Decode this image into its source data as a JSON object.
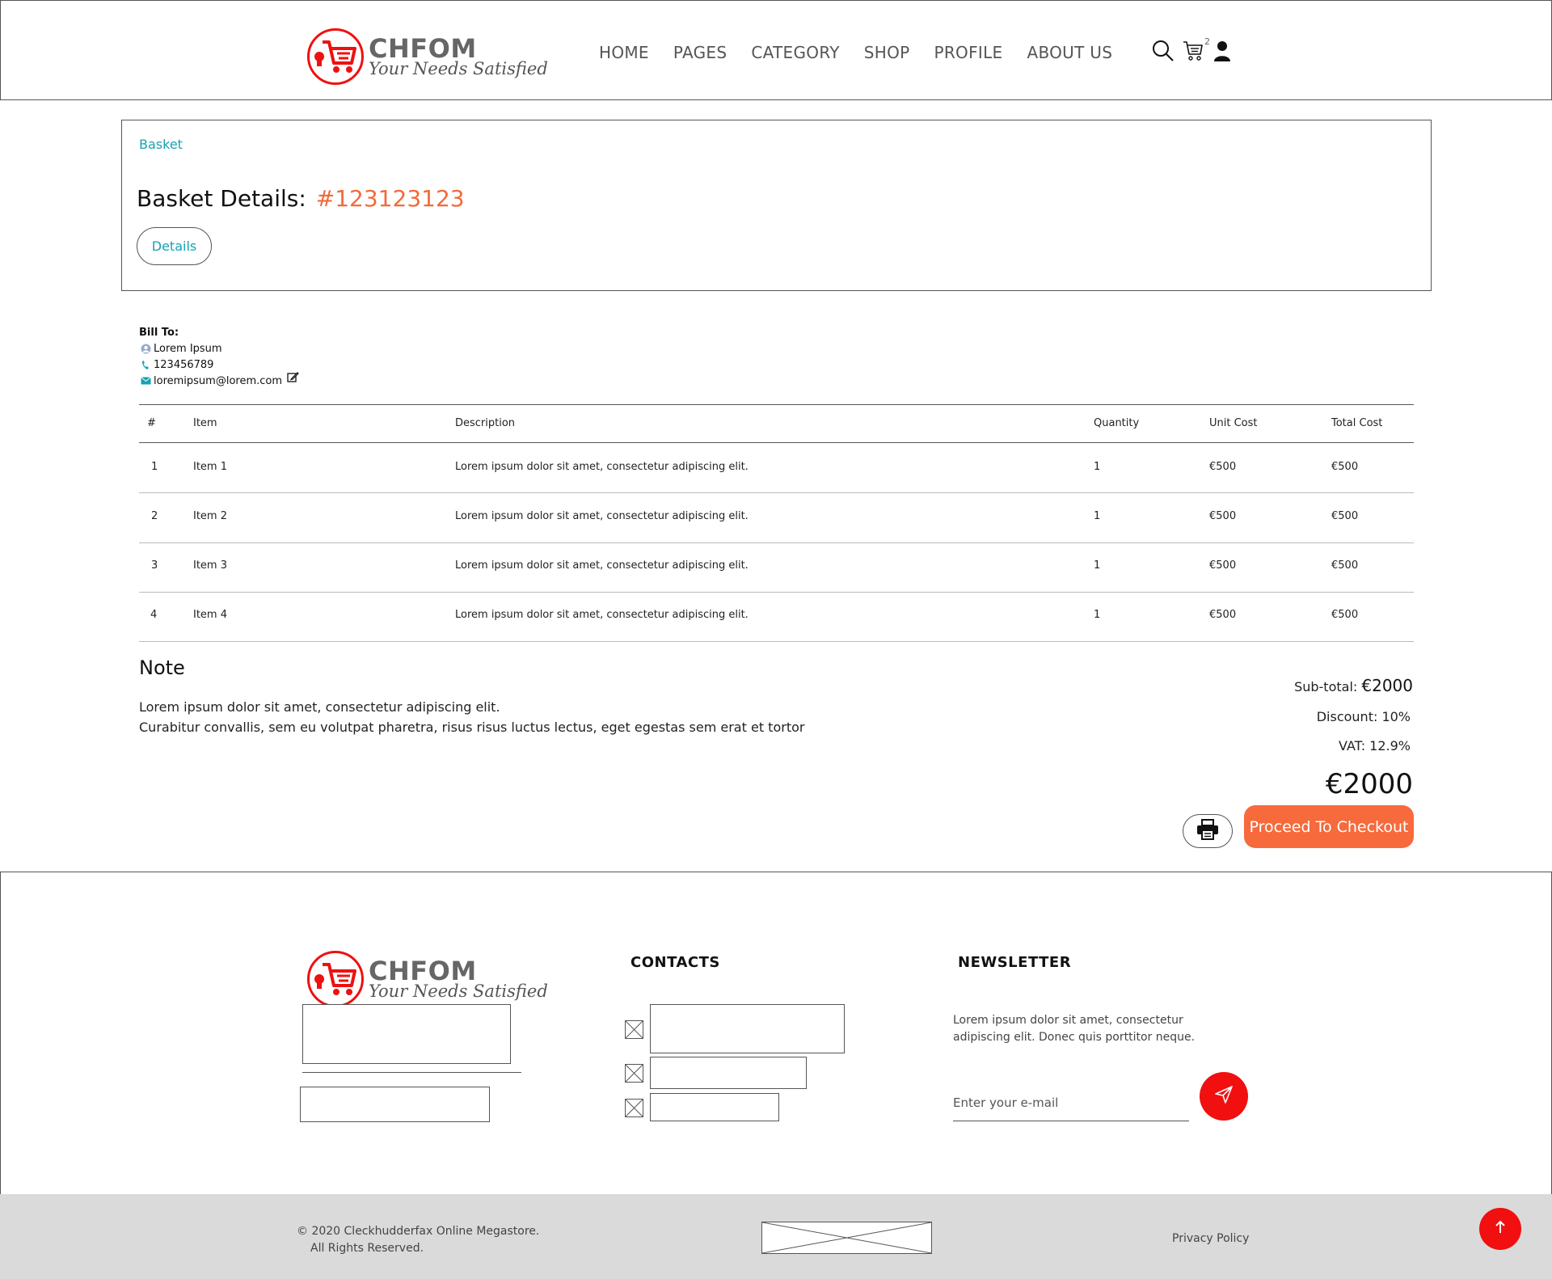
{
  "brand": {
    "name": "CHFOM",
    "tagline": "Your Needs Satisfied",
    "accent_color": "#e11111",
    "logo_icon": "cart-logo-icon"
  },
  "nav": {
    "items": [
      "HOME",
      "PAGES",
      "CATEGORY",
      "SHOP",
      "PROFILE",
      "ABOUT US"
    ],
    "cart_count": "2",
    "icons": [
      "search-icon",
      "cart-icon",
      "user-icon"
    ]
  },
  "basket": {
    "breadcrumb": "Basket",
    "title": "Basket Details:",
    "number": "#123123123",
    "details_button": "Details",
    "accent_color": "#f26a3a",
    "link_color": "#14a3b3"
  },
  "bill_to": {
    "heading": "Bill To:",
    "name": "Lorem Ipsum",
    "phone": "123456789",
    "email": "loremipsum@lorem.com"
  },
  "table": {
    "headers": [
      "#",
      "Item",
      "Description",
      "Quantity",
      "Unit Cost",
      "Total Cost"
    ],
    "rows": [
      [
        "1",
        "Item 1",
        "Lorem ipsum dolor sit amet, consectetur adipiscing elit.",
        "1",
        "€500",
        "€500"
      ],
      [
        "2",
        "Item 2",
        "Lorem ipsum dolor sit amet, consectetur adipiscing elit.",
        "1",
        "€500",
        "€500"
      ],
      [
        "3",
        "Item 3",
        "Lorem ipsum dolor sit amet, consectetur adipiscing elit.",
        "1",
        "€500",
        "€500"
      ],
      [
        "4",
        "Item 4",
        "Lorem ipsum dolor sit amet, consectetur adipiscing elit.",
        "1",
        "€500",
        "€500"
      ]
    ]
  },
  "note": {
    "heading": "Note",
    "line1": "Lorem ipsum dolor sit amet, consectetur adipiscing elit.",
    "line2": "Curabitur convallis, sem eu volutpat pharetra, risus risus luctus lectus, eget egestas sem erat et tortor"
  },
  "totals": {
    "subtotal_label": "Sub-total:",
    "subtotal_value": "€2000",
    "discount": "Discount: 10%",
    "vat": "VAT: 12.9%",
    "grand_total": "€2000",
    "checkout_button": "Proceed To Checkout",
    "checkout_color": "#f66a3c"
  },
  "footer": {
    "contacts_title": "CONTACTS",
    "newsletter_title": "NEWSLETTER",
    "newsletter_text": "Lorem ipsum dolor sit amet, consectetur adipiscing elit. Donec quis porttitor neque.",
    "email_placeholder": "Enter your e-mail",
    "copyright_line1": "© 2020 Cleckhudderfax Online Megastore.",
    "copyright_line2": "All Rights Reserved.",
    "privacy": "Privacy Policy"
  }
}
